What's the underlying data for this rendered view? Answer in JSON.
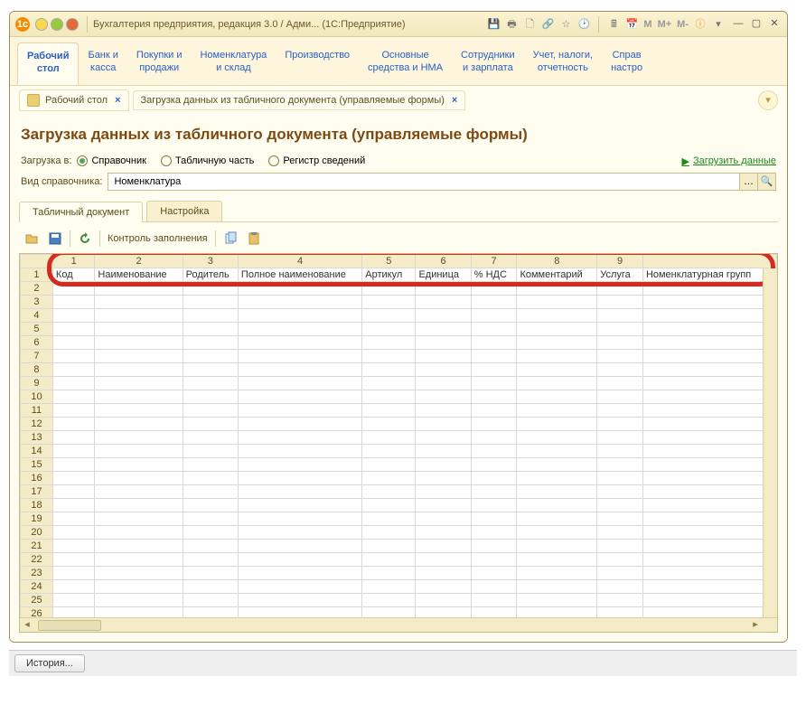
{
  "titlebar": {
    "title": "Бухгалтерия предприятия, редакция 3.0 / Адми...  (1С:Предприятие)",
    "m1": "M",
    "m2": "M+",
    "m3": "M-"
  },
  "nav": {
    "items": [
      {
        "l1": "Рабочий",
        "l2": "стол"
      },
      {
        "l1": "Банк и",
        "l2": "касса"
      },
      {
        "l1": "Покупки и",
        "l2": "продажи"
      },
      {
        "l1": "Номенклатура",
        "l2": "и склад"
      },
      {
        "l1": "Производство",
        "l2": ""
      },
      {
        "l1": "Основные",
        "l2": "средства и НМА"
      },
      {
        "l1": "Сотрудники",
        "l2": "и зарплата"
      },
      {
        "l1": "Учет, налоги,",
        "l2": "отчетность"
      },
      {
        "l1": "Справ",
        "l2": "настро"
      }
    ]
  },
  "doctabs": {
    "t1": "Рабочий стол",
    "t2": "Загрузка данных из табличного документа (управляемые формы)"
  },
  "page_title": "Загрузка данных из табличного документа (управляемые формы)",
  "load_row": {
    "label": "Загрузка в:",
    "r1": "Справочник",
    "r2": "Табличную часть",
    "r3": "Регистр сведений",
    "link": "Загрузить данные"
  },
  "dict_row": {
    "label": "Вид справочника:",
    "value": "Номенклатура"
  },
  "subtabs": {
    "t1": "Табличный документ",
    "t2": "Настройка"
  },
  "toolbar": {
    "check": "Контроль заполнения"
  },
  "sheet": {
    "cols": [
      "1",
      "2",
      "3",
      "4",
      "5",
      "6",
      "7",
      "8",
      "9",
      ""
    ],
    "headers": [
      "Код",
      "Наименование",
      "Родитель",
      "Полное наименование",
      "Артикул",
      "Единица",
      "% НДС",
      "Комментарий",
      "Услуга",
      "Номенклатурная групп"
    ],
    "rows": [
      "1",
      "2",
      "3",
      "4",
      "5",
      "6",
      "7",
      "8",
      "9",
      "10",
      "11",
      "12",
      "13",
      "14",
      "15",
      "16",
      "17",
      "18",
      "19",
      "20",
      "21",
      "22",
      "23",
      "24",
      "25",
      "26"
    ]
  },
  "history_btn": "История..."
}
